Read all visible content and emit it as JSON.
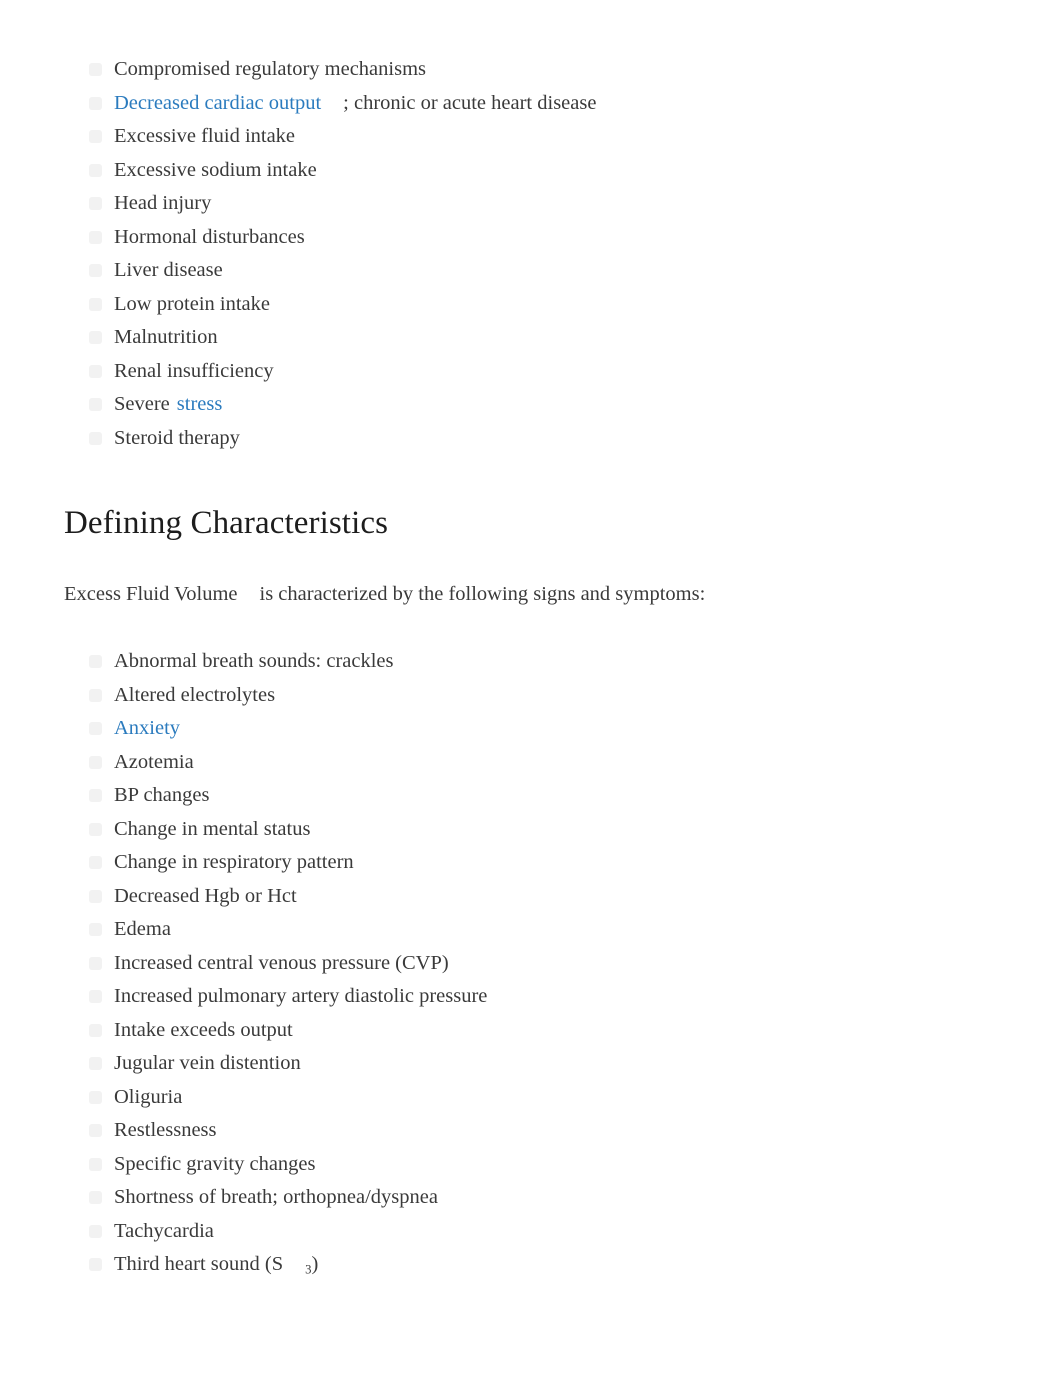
{
  "colors": {
    "text": "#3a3a3a",
    "heading": "#1d1d1d",
    "link": "#2b7bbe",
    "bullet": "#f2f2f2",
    "background": "#ffffff"
  },
  "causes_list": [
    {
      "text": "Compromised regulatory mechanisms",
      "link": null,
      "suffix": null
    },
    {
      "text": null,
      "link": "Decreased cardiac output",
      "suffix": "; chronic or acute heart disease"
    },
    {
      "text": "Excessive fluid intake",
      "link": null,
      "suffix": null
    },
    {
      "text": "Excessive sodium intake",
      "link": null,
      "suffix": null
    },
    {
      "text": "Head injury",
      "link": null,
      "suffix": null
    },
    {
      "text": "Hormonal disturbances",
      "link": null,
      "suffix": null
    },
    {
      "text": "Liver disease",
      "link": null,
      "suffix": null
    },
    {
      "text": "Low protein intake",
      "link": null,
      "suffix": null
    },
    {
      "text": "Malnutrition",
      "link": null,
      "suffix": null
    },
    {
      "text": "Renal insufficiency",
      "link": null,
      "suffix": null
    },
    {
      "text": "Severe",
      "link": "stress",
      "suffix": null
    },
    {
      "text": "Steroid therapy",
      "link": null,
      "suffix": null
    }
  ],
  "section": {
    "heading": "Defining Characteristics",
    "intro_term": "Excess Fluid Volume",
    "intro_rest": "is characterized by the following signs and symptoms:"
  },
  "characteristics_list": [
    {
      "text": "Abnormal breath sounds: crackles",
      "link": null
    },
    {
      "text": "Altered electrolytes",
      "link": null
    },
    {
      "text": null,
      "link": "Anxiety"
    },
    {
      "text": "Azotemia",
      "link": null
    },
    {
      "text": "BP changes",
      "link": null
    },
    {
      "text": "Change in mental status",
      "link": null
    },
    {
      "text": "Change in respiratory pattern",
      "link": null
    },
    {
      "text": "Decreased Hgb or Hct",
      "link": null
    },
    {
      "text": "Edema",
      "link": null
    },
    {
      "text": "Increased central venous pressure (CVP)",
      "link": null
    },
    {
      "text": "Increased pulmonary artery diastolic pressure",
      "link": null
    },
    {
      "text": "Intake exceeds output",
      "link": null
    },
    {
      "text": "Jugular vein distention",
      "link": null
    },
    {
      "text": "Oliguria",
      "link": null
    },
    {
      "text": "Restlessness",
      "link": null
    },
    {
      "text": "Specific gravity changes",
      "link": null
    },
    {
      "text": "Shortness of breath; orthopnea/dyspnea",
      "link": null
    },
    {
      "text": "Tachycardia",
      "link": null
    },
    {
      "text": "Third heart sound (S",
      "link": null,
      "subscript": "3",
      "tail": ")"
    }
  ]
}
